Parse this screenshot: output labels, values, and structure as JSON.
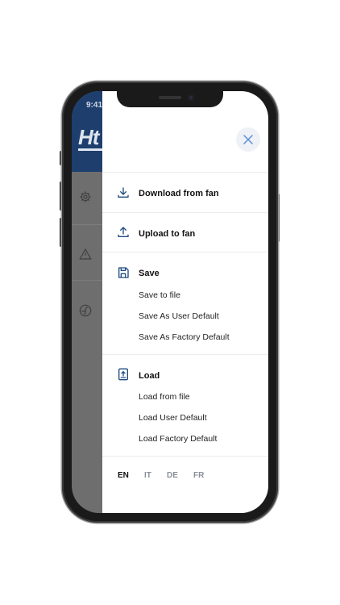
{
  "status": {
    "time": "9:41"
  },
  "app": {
    "logo_text": "Ht"
  },
  "sidebar_icons": [
    "gear-icon",
    "warning-icon",
    "fan-icon"
  ],
  "drawer": {
    "close_icon": "close-icon",
    "download": {
      "label": "Download from fan",
      "icon": "download-icon"
    },
    "upload": {
      "label": "Upload to fan",
      "icon": "upload-icon"
    },
    "save": {
      "label": "Save",
      "icon": "floppy-disk-icon",
      "items": [
        "Save to file",
        "Save As User Default",
        "Save As Factory Default"
      ]
    },
    "load": {
      "label": "Load",
      "icon": "file-upload-icon",
      "items": [
        "Load from file",
        "Load User Default",
        "Load Factory Default"
      ]
    },
    "languages": [
      {
        "code": "EN",
        "active": true
      },
      {
        "code": "IT",
        "active": false
      },
      {
        "code": "DE",
        "active": false
      },
      {
        "code": "FR",
        "active": false
      }
    ]
  },
  "colors": {
    "header": "#1e3f6e",
    "icon": "#1f4a7e",
    "close_icon": "#5b8fd6"
  }
}
